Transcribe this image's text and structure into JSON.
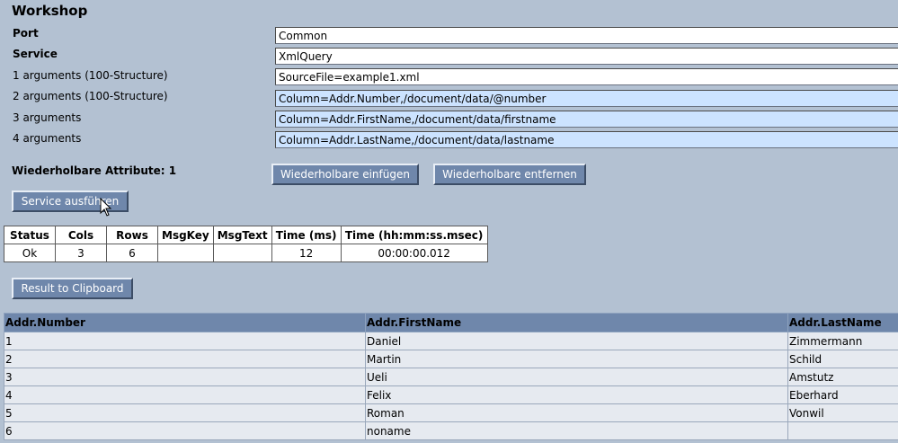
{
  "title": "Workshop",
  "form": {
    "rows": [
      {
        "label": "Port",
        "value": "Common",
        "bold": true
      },
      {
        "label": "Service",
        "value": "XmlQuery",
        "bold": true
      },
      {
        "label": "1 arguments (100-Structure)",
        "value": "SourceFile=example1.xml",
        "bold": false
      },
      {
        "label": "2 arguments (100-Structure)",
        "value": "Column=Addr.Number,/document/data/@number",
        "bold": false
      },
      {
        "label": "3 arguments",
        "value": "Column=Addr.FirstName,/document/data/firstname",
        "bold": false
      },
      {
        "label": "4 arguments",
        "value": "Column=Addr.LastName,/document/data/lastname",
        "bold": false
      }
    ],
    "repeatable_label": "Wiederholbare Attribute: 1",
    "insert_button": "Wiederholbare einfügen",
    "remove_button": "Wiederholbare entfernen",
    "execute_button": "Service ausführen"
  },
  "status_table": {
    "headers": [
      "Status",
      "Cols",
      "Rows",
      "MsgKey",
      "MsgText",
      "Time (ms)",
      "Time (hh:mm:ss.msec)"
    ],
    "row": [
      "Ok",
      "3",
      "6",
      "",
      "",
      "12",
      "00:00:00.012"
    ]
  },
  "clipboard_button": "Result to Clipboard",
  "result_table": {
    "headers": [
      "Addr.Number",
      "Addr.FirstName",
      "Addr.LastName"
    ],
    "rows": [
      [
        "1",
        "Daniel",
        "Zimmermann"
      ],
      [
        "2",
        "Martin",
        "Schild"
      ],
      [
        "3",
        "Ueli",
        "Amstutz"
      ],
      [
        "4",
        "Felix",
        "Eberhard"
      ],
      [
        "5",
        "Roman",
        "Vonwil"
      ],
      [
        "6",
        "noname",
        ""
      ]
    ]
  },
  "colors": {
    "background": "#b3c1d2",
    "button": "#6f87ab",
    "highlight_field": "#cce3ff"
  }
}
